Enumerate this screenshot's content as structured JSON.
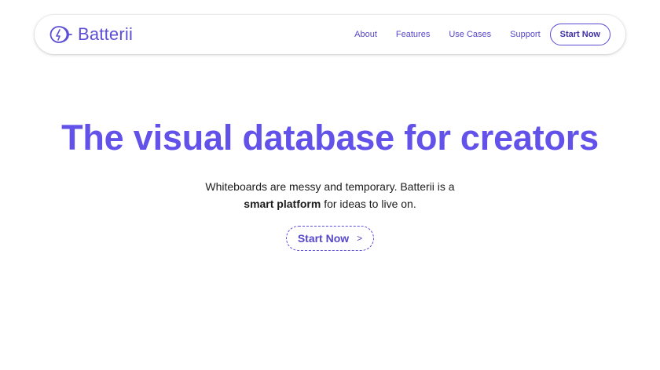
{
  "brand": {
    "name": "Batterii",
    "logo_icon": "batterii-logo-icon"
  },
  "nav": {
    "links": [
      "About",
      "Features",
      "Use Cases",
      "Support"
    ],
    "cta_label": "Start Now"
  },
  "hero": {
    "title": "The visual database for creators",
    "subtitle_line1": "Whiteboards are messy and temporary. Batterii is a",
    "subtitle_bold": "smart platform",
    "subtitle_rest": " for ideas to live on.",
    "cta_label": "Start Now",
    "cta_icon": "chevron-right-icon"
  },
  "colors": {
    "accent": "#6352ea",
    "nav_text": "#5547c8",
    "body_text": "#1c1c1c"
  }
}
